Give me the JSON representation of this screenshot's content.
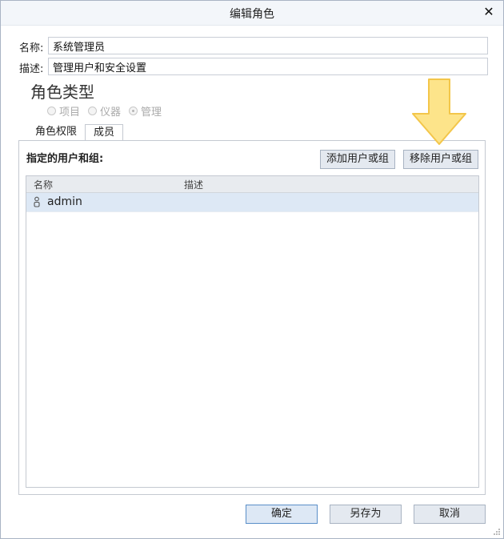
{
  "window": {
    "title": "编辑角色",
    "close_icon": "close-icon"
  },
  "form": {
    "name_label": "名称:",
    "name_value": "系统管理员",
    "desc_label": "描述:",
    "desc_value": "管理用户和安全设置"
  },
  "role_type": {
    "title": "角色类型",
    "options": [
      {
        "label": "项目",
        "checked": false
      },
      {
        "label": "仪器",
        "checked": false
      },
      {
        "label": "管理",
        "checked": true
      }
    ]
  },
  "tabs": [
    {
      "label": "角色权限",
      "active": false
    },
    {
      "label": "成员",
      "active": true
    }
  ],
  "members": {
    "label": "指定的用户和组:",
    "add_button": "添加用户或组",
    "remove_button": "移除用户或组",
    "columns": {
      "name": "名称",
      "description": "描述"
    },
    "rows": [
      {
        "name": "admin",
        "description": "",
        "icon": "user-icon"
      }
    ]
  },
  "footer": {
    "ok": "确定",
    "save_as": "另存为",
    "cancel": "取消"
  },
  "colors": {
    "arrow_fill": "#fde48a",
    "arrow_stroke": "#f3c64a",
    "row_selected": "#dde8f5"
  }
}
